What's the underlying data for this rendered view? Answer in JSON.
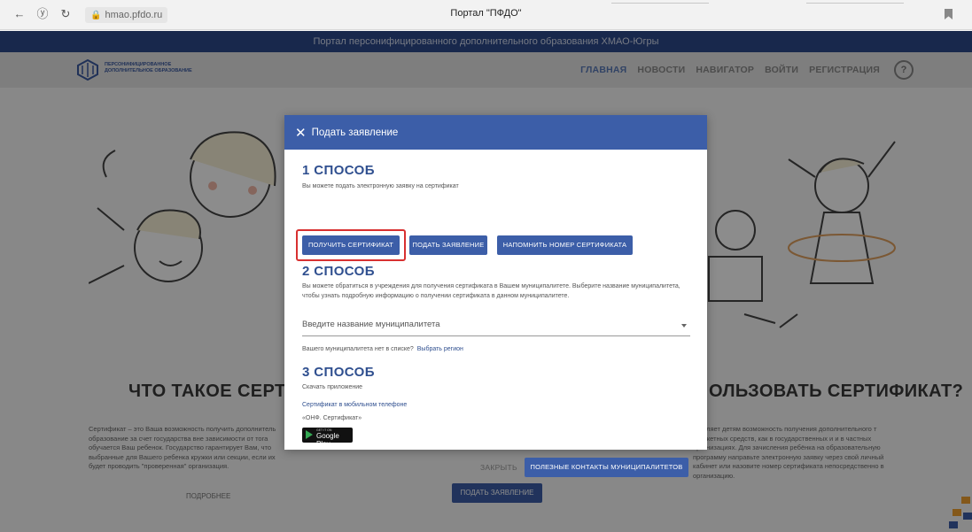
{
  "browser": {
    "url": "hmao.pfdo.ru",
    "tab_title": "Портал \"ПФДО\""
  },
  "site": {
    "banner": "Портал персонифицированного дополнительного образования ХМАО-Югры",
    "logo_text": "ПЕРСОНИФИЦИРОВАННОЕ ДОПОЛНИТЕЛЬНОЕ ОБРАЗОВАНИЕ",
    "nav": [
      "ГЛАВНАЯ",
      "НОВОСТИ",
      "НАВИГАТОР",
      "ВОЙТИ",
      "РЕГИСТРАЦИЯ"
    ],
    "help": "?"
  },
  "page": {
    "left_heading": "ЧТО ТАКОЕ СЕРТИФИК",
    "right_heading": "ОЛЬЗОВАТЬ СЕРТИФИКАТ?",
    "left_para": "Сертификат – это Ваша возможность получить дополнитель образование за счет государства вне зависимости от тога обучается Ваш ребенок. Государство гарантирует Вам, что выбранные для Вашего ребенка кружки или секции, если их будет проводить \"проверенная\" организация.",
    "right_para": "ставляет детям возможность получения дополнительного т бюджетных средств, как в государственных и и в частных организациях. Для зачисления ребёнка на образовательную программу направьте электронную заявку через свой личный кабинет или назовите номер сертификата непосредственно в организацию.",
    "more_link": "ПОДРОБНЕЕ",
    "apply_button": "ПОДАТЬ ЗАЯВЛЕНИЕ"
  },
  "modal": {
    "title": "Подать заявление",
    "method1": {
      "title": "1 СПОСОБ",
      "desc": "Вы можете подать электронную заявку на сертификат",
      "buttons": [
        "ПОЛУЧИТЬ СЕРТИФИКАТ",
        "ПОДАТЬ ЗАЯВЛЕНИЕ",
        "НАПОМНИТЬ НОМЕР СЕРТИФИКАТА"
      ]
    },
    "method2": {
      "title": "2 СПОСОБ",
      "desc": "Вы можете обратиться в учреждения для получения сертификата в Вашем муниципалитете. Выберите название муниципалитета, чтобы узнать подробную информацию о получении сертификата в данном муниципалитете.",
      "select_placeholder": "Введите название муниципалитета",
      "note": "Вашего муниципалитета нет в списке?",
      "note_link": "Выбрать регион"
    },
    "method3": {
      "title": "3 СПОСОБ",
      "desc": "Скачать приложение",
      "mobile_link": "Сертификат в мобильном телефоне",
      "app_name": "«ОНФ. Сертификат»",
      "store_small": "GET IT ON",
      "store": "Google Play"
    },
    "close_button": "ЗАКРЫТЬ",
    "contacts_button": "ПОЛЕЗНЫЕ КОНТАКТЫ МУНИЦИПАЛИТЕТОВ"
  },
  "colors": {
    "primary": "#3c5ea8",
    "highlight": "#d83030",
    "banner": "#2d4a8a"
  }
}
